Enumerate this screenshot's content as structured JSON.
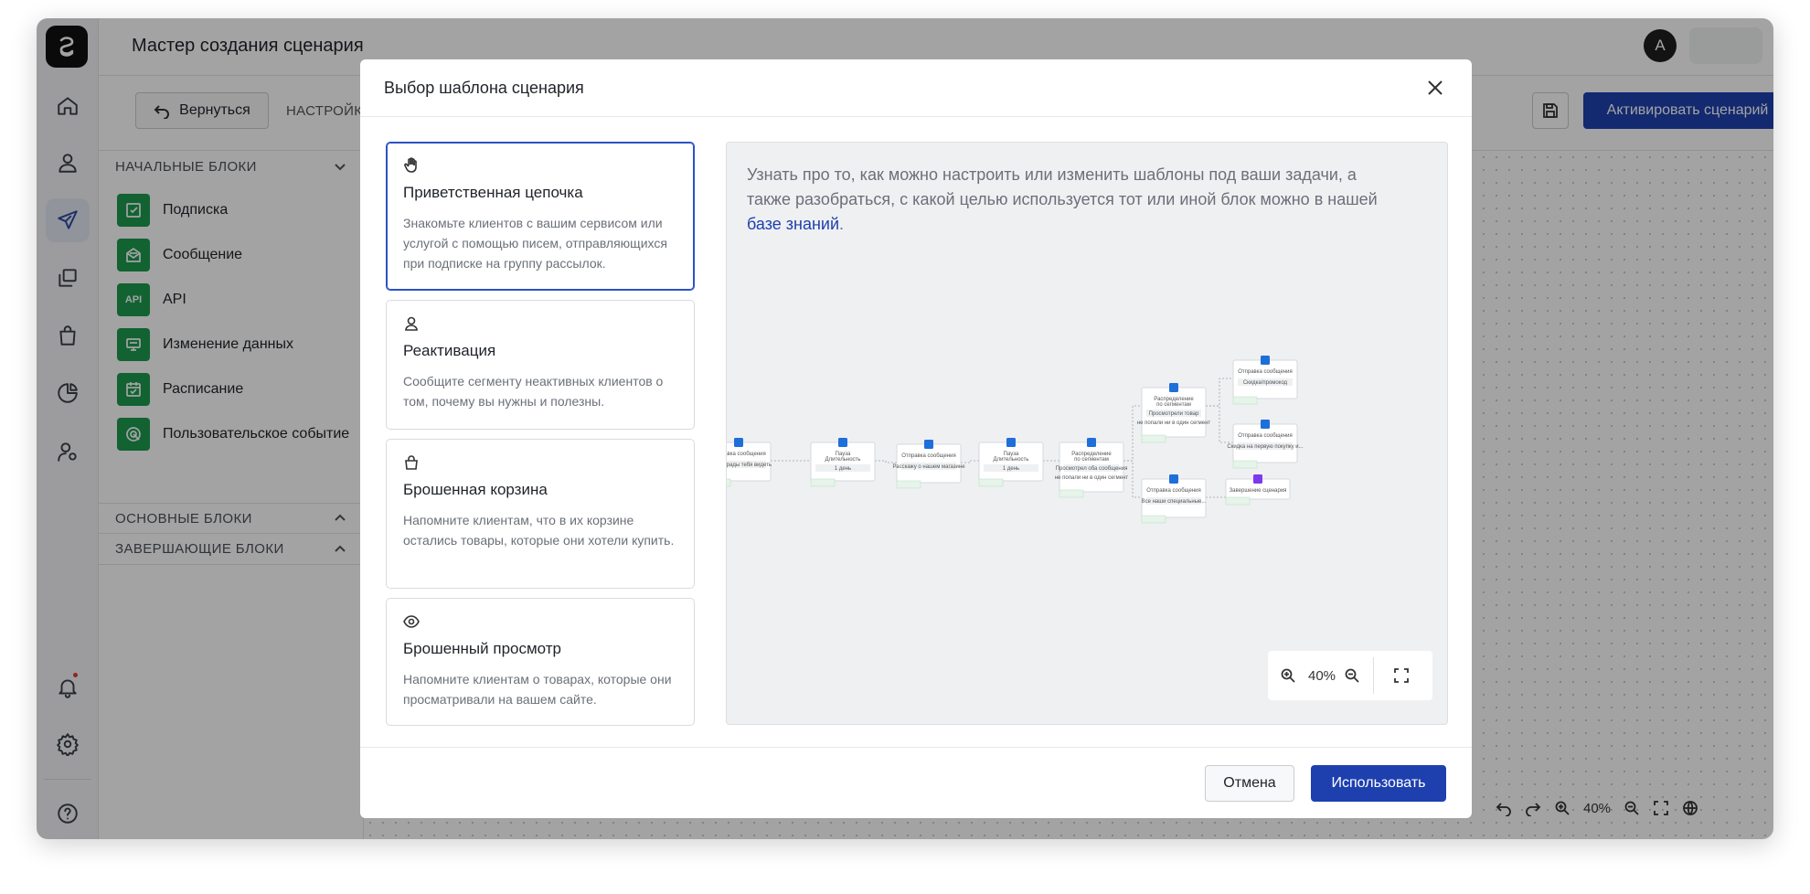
{
  "app": {
    "page_title": "Мастер создания сценария",
    "avatar_initial": "A",
    "back_label": "Вернуться",
    "tab_settings_label": "НАСТРОЙК",
    "activate_label": "Активировать сценарий",
    "accent": "#1e40af",
    "block_color": "#1d9a4f"
  },
  "sidebar": {
    "start_section": "НАЧАЛЬНЫЕ БЛОКИ",
    "main_section": "ОСНОВНЫЕ БЛОКИ",
    "end_section": "ЗАВЕРШАЮЩИЕ БЛОКИ",
    "blocks": [
      {
        "label": "Подписка",
        "icon": "checkbox-icon"
      },
      {
        "label": "Сообщение",
        "icon": "mail-open-icon"
      },
      {
        "label": "API",
        "icon": "api-icon",
        "icon_text": "API"
      },
      {
        "label": "Изменение данных",
        "icon": "data-change-icon"
      },
      {
        "label": "Расписание",
        "icon": "calendar-icon"
      },
      {
        "label": "Пользовательское событие",
        "icon": "target-icon"
      }
    ]
  },
  "canvas_controls": {
    "zoom": "40%"
  },
  "modal": {
    "title": "Выбор шаблона сценария",
    "templates": [
      {
        "title": "Приветственная цепочка",
        "desc": "Знакомьте клиентов с вашим сервисом или услугой с помощью писем, отправляющихся при подписке на группу рассылок.",
        "icon": "hand-icon",
        "selected": true
      },
      {
        "title": "Реактивация",
        "desc": "Сообщите сегменту неактивных клиентов о том, почему вы нужны и полезны.",
        "icon": "user-icon",
        "selected": false
      },
      {
        "title": "Брошенная корзина",
        "desc": "Напомните клиентам, что в их корзине остались товары, которые они хотели купить.",
        "icon": "bag-icon",
        "selected": false
      },
      {
        "title": "Брошенный просмотр",
        "desc": "Напомните клиентам о товарах, которые они просматривали на вашем сайте.",
        "icon": "eye-icon",
        "selected": false
      }
    ],
    "info_text": "Узнать про то, как можно настроить или изменить шаблоны под ваши задачи, а также разобраться, с какой целью используется тот или иной блок можно в нашей ",
    "info_link": "базе знаний",
    "info_end": ".",
    "preview_zoom": "40%",
    "cancel_label": "Отмена",
    "use_label": "Использовать",
    "flow_nodes": [
      {
        "title": "Отправка сообщения",
        "sub": "",
        "body": "Привет, рады тебя видеть",
        "kind": "message"
      },
      {
        "title": "Пауза",
        "sub": "Длительность",
        "body": "1 день",
        "kind": "pause"
      },
      {
        "title": "Отправка сообщения",
        "sub": "",
        "body": "Расскажу о нашем магазине",
        "kind": "message"
      },
      {
        "title": "Пауза",
        "sub": "Длительность",
        "body": "1 день",
        "kind": "pause"
      },
      {
        "title": "Распределение",
        "sub": "по сегментам",
        "body": "Просмотрел оба сообщения",
        "extra": "не попали ни в один сегмент",
        "kind": "split"
      },
      {
        "title": "Распределение",
        "sub": "по сегментам",
        "body": "Просмотрели товар",
        "extra": "не попали ни в один сегмент",
        "kind": "split"
      },
      {
        "title": "Отправка сообщения",
        "sub": "",
        "body": "Все наши специальные...",
        "kind": "message"
      },
      {
        "title": "Отправка сообщения",
        "sub": "",
        "body": "Скидка/промокод",
        "kind": "message"
      },
      {
        "title": "Отправка сообщения",
        "sub": "",
        "body": "Скидка на первую покупку и...",
        "kind": "message"
      },
      {
        "title": "Завершение сценария",
        "sub": "",
        "body": "",
        "kind": "end"
      }
    ]
  }
}
